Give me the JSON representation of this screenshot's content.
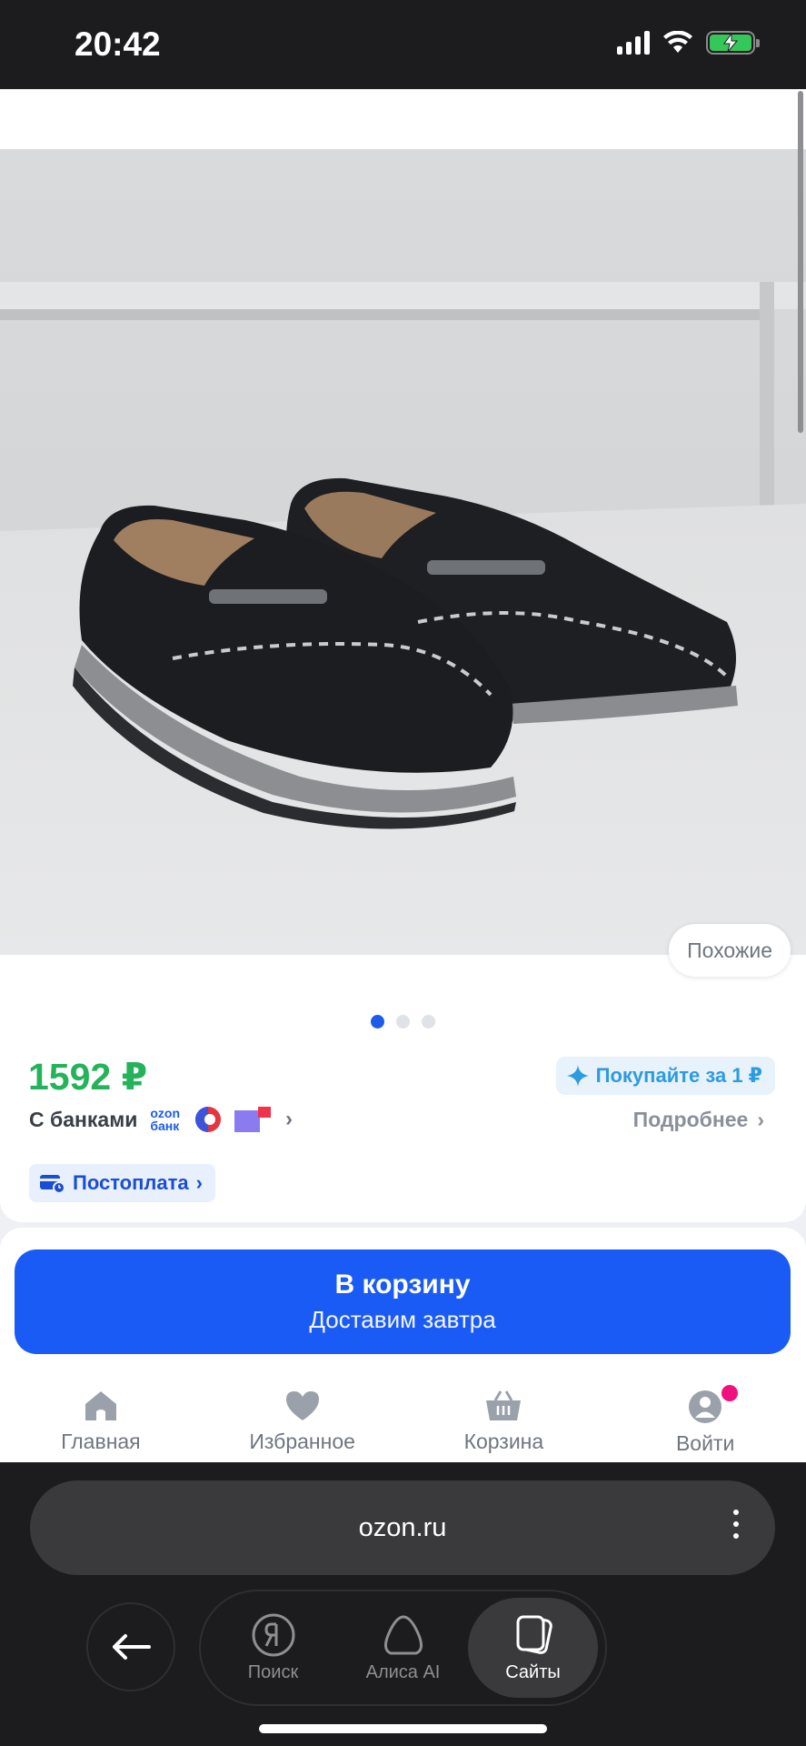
{
  "status_bar": {
    "time": "20:42"
  },
  "product": {
    "similar_label": "Похожие",
    "price": "1592 ₽",
    "promo": "Покупайте за 1 ₽",
    "banks_label": "С банками",
    "ozon_bank_line1": "ozon",
    "ozon_bank_line2": "банк",
    "details_label": "Подробнее",
    "postpay_label": "Постоплата",
    "images": {
      "count": 3,
      "active": 1
    }
  },
  "cart": {
    "title": "В корзину",
    "subtitle": "Доставим завтра"
  },
  "bottom_nav": [
    {
      "label": "Главная",
      "icon": "home-icon"
    },
    {
      "label": "Избранное",
      "icon": "heart-icon"
    },
    {
      "label": "Корзина",
      "icon": "basket-icon"
    },
    {
      "label": "Войти",
      "icon": "user-icon"
    }
  ],
  "browser": {
    "url": "ozon.ru",
    "tabs": [
      {
        "label": "Поиск",
        "icon": "yandex-icon"
      },
      {
        "label": "Алиса AI",
        "icon": "alice-icon"
      },
      {
        "label": "Сайты",
        "icon": "tabs-icon"
      }
    ]
  },
  "colors": {
    "accent": "#1b5bf5",
    "price": "#24b35a",
    "badge": "#f1117e"
  }
}
